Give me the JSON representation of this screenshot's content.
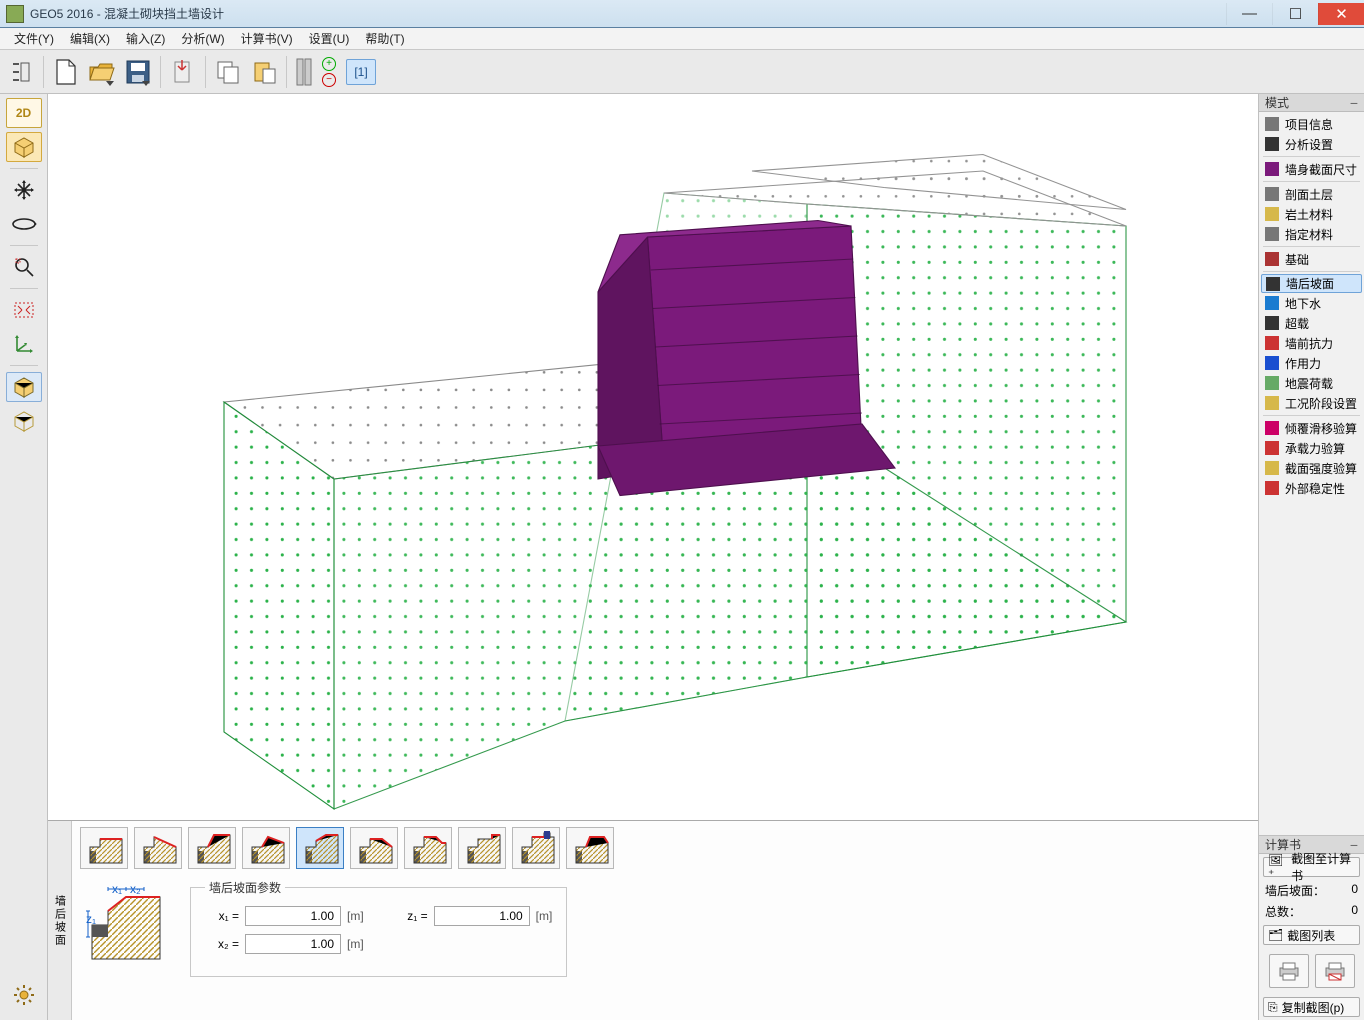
{
  "title": "GEO5 2016 - 混凝土砌块挡土墙设计",
  "menu": {
    "file": "文件(Y)",
    "edit": "编辑(X)",
    "input": "输入(Z)",
    "analysis": "分析(W)",
    "calcbook": "计算书(V)",
    "settings": "设置(U)",
    "help": "帮助(T)"
  },
  "toolbar": {
    "stage": "[1]"
  },
  "left": {
    "btn2d": "2D",
    "btn3d": "3D"
  },
  "modes": {
    "header": "模式",
    "items": [
      "项目信息",
      "分析设置",
      "墙身截面尺寸",
      "剖面土层",
      "岩土材料",
      "指定材料",
      "基础",
      "墙后坡面",
      "地下水",
      "超载",
      "墙前抗力",
      "作用力",
      "地震荷载",
      "工况阶段设置",
      "倾覆滑移验算",
      "承载力验算",
      "截面强度验算",
      "外部稳定性"
    ],
    "selected_index": 7
  },
  "bottom": {
    "side_label": "墙后坡面",
    "shapes_count": 10,
    "selected_shape": 4,
    "group_title": "墙后坡面参数",
    "x1_label": "x₁ =",
    "x2_label": "x₂ =",
    "z1_label": "z₁ =",
    "x1": "1.00",
    "x2": "1.00",
    "z1": "1.00",
    "unit": "[m]",
    "thumb_labels": {
      "x1": "x₁",
      "x2": "x₂",
      "z1": "z₁"
    }
  },
  "calc": {
    "header": "计算书",
    "to_book": "截图至计算书",
    "line1_label": "墙后坡面：",
    "line1_val": "0",
    "line2_label": "总数：",
    "line2_val": "0",
    "list_btn": "截图列表",
    "copy": "复制截图(p)"
  }
}
